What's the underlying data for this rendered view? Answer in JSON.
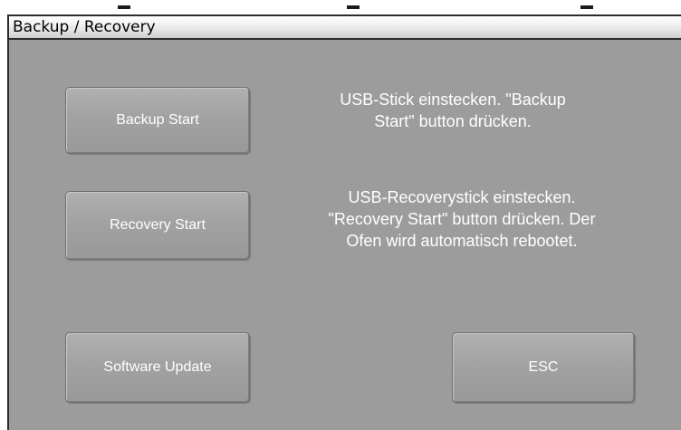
{
  "window": {
    "title": "Backup / Recovery"
  },
  "buttons": {
    "backup_start": "Backup Start",
    "recovery_start": "Recovery Start",
    "software_update": "Software Update",
    "esc": "ESC"
  },
  "instructions": {
    "backup": [
      "USB-Stick einstecken. \"Backup",
      "Start\" button drücken."
    ],
    "recovery": [
      "USB-Recoverystick einstecken.",
      "\"Recovery Start\" button drücken. Der",
      "Ofen wird automatisch rebootet."
    ]
  },
  "colors": {
    "panel_background": "#9c9c9c",
    "button_text": "#ffffff",
    "instruction_text": "#ffffff",
    "titlebar": "#e6e6e6"
  }
}
